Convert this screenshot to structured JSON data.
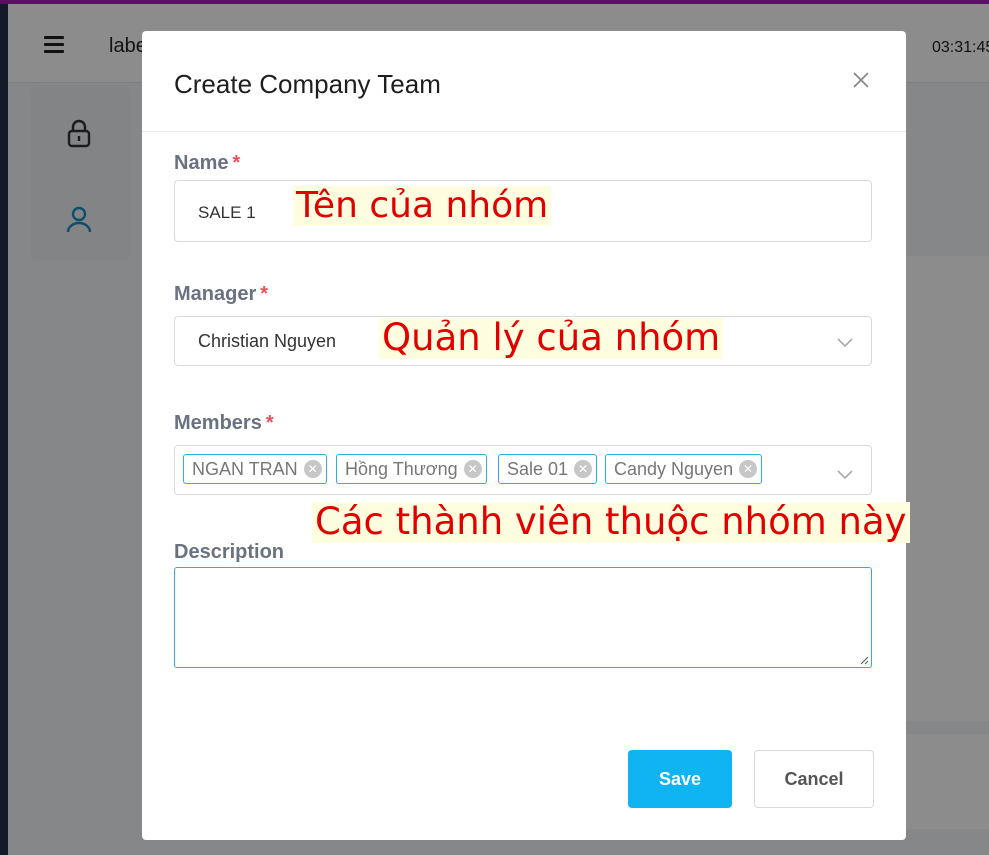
{
  "app": {
    "header_label": "labe",
    "time": "03:31:45",
    "icons": [
      "hamburger-icon",
      "lock-icon",
      "user-icon"
    ]
  },
  "modal": {
    "title": "Create Company Team",
    "name": {
      "label": "Name",
      "required_mark": "*",
      "value": "SALE 1",
      "annotation": "Tên của nhóm"
    },
    "manager": {
      "label": "Manager",
      "required_mark": "*",
      "value": "Christian Nguyen",
      "annotation": "Quản lý của nhóm"
    },
    "members": {
      "label": "Members",
      "required_mark": "*",
      "tags": [
        "NGAN TRAN",
        "Hồng Thương",
        "Sale 01",
        "Candy Nguyen"
      ],
      "annotation": "Các thành viên thuộc nhóm này"
    },
    "description": {
      "label": "Description",
      "value": ""
    },
    "buttons": {
      "save": "Save",
      "cancel": "Cancel"
    }
  },
  "colors": {
    "accent": "#0fb4f0",
    "required": "#e8505b",
    "annotation_text": "#e00000",
    "annotation_bg": "#fffde0",
    "top_line": "#a11fb0"
  }
}
